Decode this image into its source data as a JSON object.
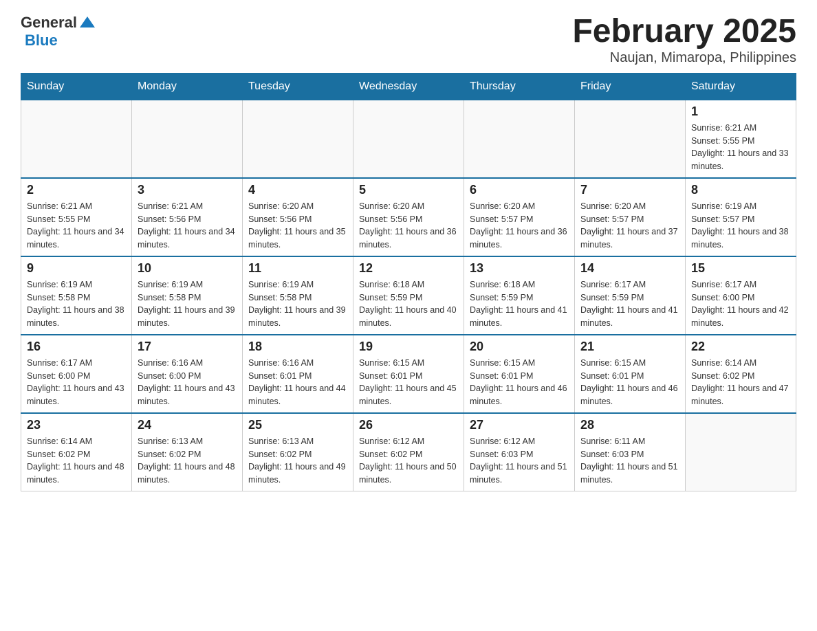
{
  "header": {
    "logo": {
      "general_text": "General",
      "blue_text": "Blue"
    },
    "title": "February 2025",
    "location": "Naujan, Mimaropa, Philippines"
  },
  "days_of_week": [
    "Sunday",
    "Monday",
    "Tuesday",
    "Wednesday",
    "Thursday",
    "Friday",
    "Saturday"
  ],
  "weeks": [
    {
      "days": [
        {
          "number": "",
          "info": ""
        },
        {
          "number": "",
          "info": ""
        },
        {
          "number": "",
          "info": ""
        },
        {
          "number": "",
          "info": ""
        },
        {
          "number": "",
          "info": ""
        },
        {
          "number": "",
          "info": ""
        },
        {
          "number": "1",
          "info": "Sunrise: 6:21 AM\nSunset: 5:55 PM\nDaylight: 11 hours and 33 minutes."
        }
      ]
    },
    {
      "days": [
        {
          "number": "2",
          "info": "Sunrise: 6:21 AM\nSunset: 5:55 PM\nDaylight: 11 hours and 34 minutes."
        },
        {
          "number": "3",
          "info": "Sunrise: 6:21 AM\nSunset: 5:56 PM\nDaylight: 11 hours and 34 minutes."
        },
        {
          "number": "4",
          "info": "Sunrise: 6:20 AM\nSunset: 5:56 PM\nDaylight: 11 hours and 35 minutes."
        },
        {
          "number": "5",
          "info": "Sunrise: 6:20 AM\nSunset: 5:56 PM\nDaylight: 11 hours and 36 minutes."
        },
        {
          "number": "6",
          "info": "Sunrise: 6:20 AM\nSunset: 5:57 PM\nDaylight: 11 hours and 36 minutes."
        },
        {
          "number": "7",
          "info": "Sunrise: 6:20 AM\nSunset: 5:57 PM\nDaylight: 11 hours and 37 minutes."
        },
        {
          "number": "8",
          "info": "Sunrise: 6:19 AM\nSunset: 5:57 PM\nDaylight: 11 hours and 38 minutes."
        }
      ]
    },
    {
      "days": [
        {
          "number": "9",
          "info": "Sunrise: 6:19 AM\nSunset: 5:58 PM\nDaylight: 11 hours and 38 minutes."
        },
        {
          "number": "10",
          "info": "Sunrise: 6:19 AM\nSunset: 5:58 PM\nDaylight: 11 hours and 39 minutes."
        },
        {
          "number": "11",
          "info": "Sunrise: 6:19 AM\nSunset: 5:58 PM\nDaylight: 11 hours and 39 minutes."
        },
        {
          "number": "12",
          "info": "Sunrise: 6:18 AM\nSunset: 5:59 PM\nDaylight: 11 hours and 40 minutes."
        },
        {
          "number": "13",
          "info": "Sunrise: 6:18 AM\nSunset: 5:59 PM\nDaylight: 11 hours and 41 minutes."
        },
        {
          "number": "14",
          "info": "Sunrise: 6:17 AM\nSunset: 5:59 PM\nDaylight: 11 hours and 41 minutes."
        },
        {
          "number": "15",
          "info": "Sunrise: 6:17 AM\nSunset: 6:00 PM\nDaylight: 11 hours and 42 minutes."
        }
      ]
    },
    {
      "days": [
        {
          "number": "16",
          "info": "Sunrise: 6:17 AM\nSunset: 6:00 PM\nDaylight: 11 hours and 43 minutes."
        },
        {
          "number": "17",
          "info": "Sunrise: 6:16 AM\nSunset: 6:00 PM\nDaylight: 11 hours and 43 minutes."
        },
        {
          "number": "18",
          "info": "Sunrise: 6:16 AM\nSunset: 6:01 PM\nDaylight: 11 hours and 44 minutes."
        },
        {
          "number": "19",
          "info": "Sunrise: 6:15 AM\nSunset: 6:01 PM\nDaylight: 11 hours and 45 minutes."
        },
        {
          "number": "20",
          "info": "Sunrise: 6:15 AM\nSunset: 6:01 PM\nDaylight: 11 hours and 46 minutes."
        },
        {
          "number": "21",
          "info": "Sunrise: 6:15 AM\nSunset: 6:01 PM\nDaylight: 11 hours and 46 minutes."
        },
        {
          "number": "22",
          "info": "Sunrise: 6:14 AM\nSunset: 6:02 PM\nDaylight: 11 hours and 47 minutes."
        }
      ]
    },
    {
      "days": [
        {
          "number": "23",
          "info": "Sunrise: 6:14 AM\nSunset: 6:02 PM\nDaylight: 11 hours and 48 minutes."
        },
        {
          "number": "24",
          "info": "Sunrise: 6:13 AM\nSunset: 6:02 PM\nDaylight: 11 hours and 48 minutes."
        },
        {
          "number": "25",
          "info": "Sunrise: 6:13 AM\nSunset: 6:02 PM\nDaylight: 11 hours and 49 minutes."
        },
        {
          "number": "26",
          "info": "Sunrise: 6:12 AM\nSunset: 6:02 PM\nDaylight: 11 hours and 50 minutes."
        },
        {
          "number": "27",
          "info": "Sunrise: 6:12 AM\nSunset: 6:03 PM\nDaylight: 11 hours and 51 minutes."
        },
        {
          "number": "28",
          "info": "Sunrise: 6:11 AM\nSunset: 6:03 PM\nDaylight: 11 hours and 51 minutes."
        },
        {
          "number": "",
          "info": ""
        }
      ]
    }
  ]
}
